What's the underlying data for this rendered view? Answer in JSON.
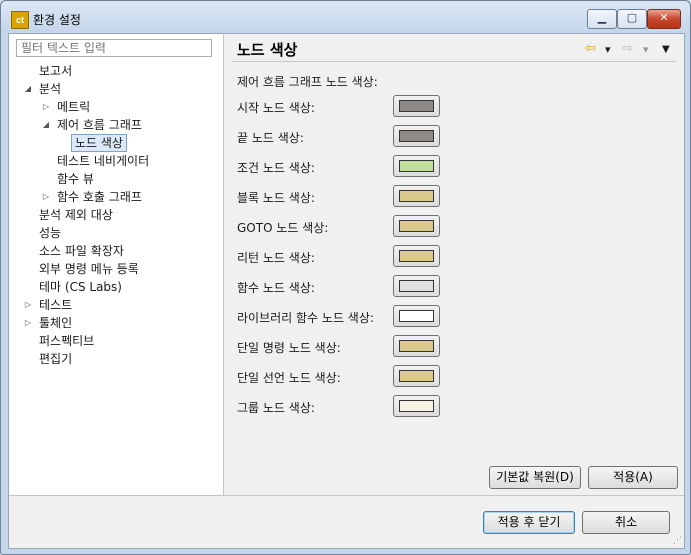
{
  "window": {
    "icon_text": "ct",
    "title": "환경 설정",
    "min_glyph": "▁",
    "max_glyph": "▢",
    "close_glyph": "✕"
  },
  "filter": {
    "placeholder": "필터 텍스트 입력"
  },
  "tree": [
    {
      "label": "보고서",
      "depth": 0,
      "twisty": ""
    },
    {
      "label": "분석",
      "depth": 0,
      "twisty": "expanded"
    },
    {
      "label": "메트릭",
      "depth": 1,
      "twisty": "collapsed"
    },
    {
      "label": "제어 흐름 그래프",
      "depth": 1,
      "twisty": "expanded"
    },
    {
      "label": "노드 색상",
      "depth": 2,
      "twisty": "",
      "selected": true
    },
    {
      "label": "테스트 네비게이터",
      "depth": 1,
      "twisty": ""
    },
    {
      "label": "함수 뷰",
      "depth": 1,
      "twisty": ""
    },
    {
      "label": "함수 호출 그래프",
      "depth": 1,
      "twisty": "collapsed"
    },
    {
      "label": "분석 제외 대상",
      "depth": 0,
      "twisty": ""
    },
    {
      "label": "성능",
      "depth": 0,
      "twisty": ""
    },
    {
      "label": "소스 파일 확장자",
      "depth": 0,
      "twisty": ""
    },
    {
      "label": "외부 명령 메뉴 등록",
      "depth": 0,
      "twisty": ""
    },
    {
      "label": "테마 (CS Labs)",
      "depth": 0,
      "twisty": ""
    },
    {
      "label": "테스트",
      "depth": 0,
      "twisty": "collapsed"
    },
    {
      "label": "툴체인",
      "depth": 0,
      "twisty": "collapsed"
    },
    {
      "label": "퍼스펙티브",
      "depth": 0,
      "twisty": ""
    },
    {
      "label": "편집기",
      "depth": 0,
      "twisty": ""
    }
  ],
  "page": {
    "title": "노드 색상",
    "section_label": "제어 흐름 그래프 노드 색상:",
    "nav": {
      "back_icon": "⇦",
      "back_menu_icon": "▾",
      "forward_icon": "⇨",
      "forward_menu_icon": "▾",
      "view_menu_icon": "▼"
    },
    "colors": [
      {
        "label": "시작 노드 색상:",
        "color": "#8f8a86"
      },
      {
        "label": "끝 노드 색상:",
        "color": "#8f8a86"
      },
      {
        "label": "조건 노드 색상:",
        "color": "#c3e09a"
      },
      {
        "label": "블록 노드 색상:",
        "color": "#dcc98d"
      },
      {
        "label": "GOTO 노드 색상:",
        "color": "#dcc98d"
      },
      {
        "label": "리턴 노드 색상:",
        "color": "#dcc98d"
      },
      {
        "label": "함수 노드 색상:",
        "color": "#e1e1e1"
      },
      {
        "label": "라이브러리 함수 노드 색상:",
        "color": "#ffffff"
      },
      {
        "label": "단일 명령 노드 색상:",
        "color": "#dcc98d"
      },
      {
        "label": "단일 선언 노드 색상:",
        "color": "#dcc98d"
      },
      {
        "label": "그룹 노드 색상:",
        "color": "#f7f4e6"
      }
    ],
    "restore_defaults": "기본값 복원(D)",
    "apply": "적용(A)"
  },
  "footer": {
    "apply_close": "적용 후 닫기",
    "cancel": "취소"
  }
}
